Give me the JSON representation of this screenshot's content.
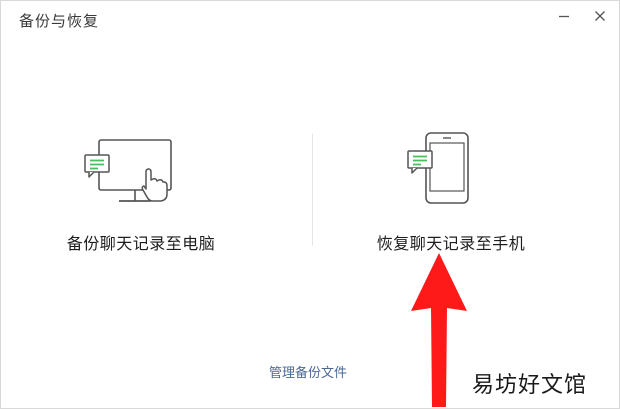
{
  "window": {
    "title": "备份与恢复"
  },
  "options": {
    "backup": {
      "label": "备份聊天记录至电脑",
      "icon": "monitor-chat-icon"
    },
    "restore": {
      "label": "恢复聊天记录至手机",
      "icon": "phone-chat-icon"
    }
  },
  "footer": {
    "manage_link": "管理备份文件"
  },
  "overlay": {
    "watermark": "易坊好文馆",
    "annotation": "red-up-arrow"
  },
  "colors": {
    "accent_green": "#4bbf5f",
    "link_blue": "#4b6796",
    "arrow_red": "#ff1a1a",
    "icon_stroke": "#555555"
  }
}
